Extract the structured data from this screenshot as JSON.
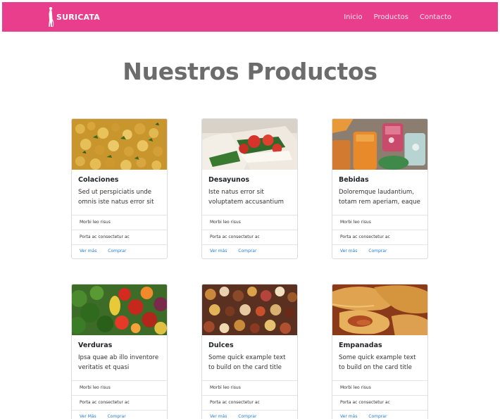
{
  "navbar": {
    "brand": "SURICATA",
    "bg_color": "#e83e8c",
    "links": [
      "Inicio",
      "Productos",
      "Contacto"
    ]
  },
  "page_title": "Nuestros Productos",
  "cards": [
    {
      "title": "Colaciones",
      "text": "Sed ut perspiciatis unde omnis iste natus error sit",
      "list": [
        "Morbi leo risus",
        "Porta ac consectetur ac"
      ],
      "links": [
        "Ver más",
        "Comprar"
      ],
      "image": "chickpea-stew-photo"
    },
    {
      "title": "Desayunos",
      "text": "Iste natus error sit voluptatem accusantium",
      "list": [
        "Morbi leo risus",
        "Porta ac consectetur ac"
      ],
      "links": [
        "Ver más",
        "Comprar"
      ],
      "image": "sandwich-photo"
    },
    {
      "title": "Bebidas",
      "text": "Doloremque laudantium, totam rem aperiam, eaque",
      "list": [
        "Morbi leo risus",
        "Porta ac consectetur ac"
      ],
      "links": [
        "Ver más",
        "Comprar"
      ],
      "image": "drinks-photo"
    },
    {
      "title": "Verduras",
      "text": "Ipsa quae ab illo inventore veritatis et quasi architecto",
      "list": [
        "Morbi leo risus",
        "Porta ac consectetur ac"
      ],
      "links": [
        "Ver Más",
        "Comprar"
      ],
      "image": "vegetables-photo"
    },
    {
      "title": "Dulces",
      "text": "Some quick example text to build on the card title and",
      "list": [
        "Morbi leo risus",
        "Porta ac consectetur ac"
      ],
      "links": [
        "Ver más",
        "Comprar"
      ],
      "image": "sweets-photo"
    },
    {
      "title": "Empanadas",
      "text": "Some quick example text to build on the card title and",
      "list": [
        "Morbi leo risus",
        "Porta ac consectetur ac"
      ],
      "links": [
        "Ver más",
        "Comprar"
      ],
      "image": "empanadas-photo"
    }
  ]
}
